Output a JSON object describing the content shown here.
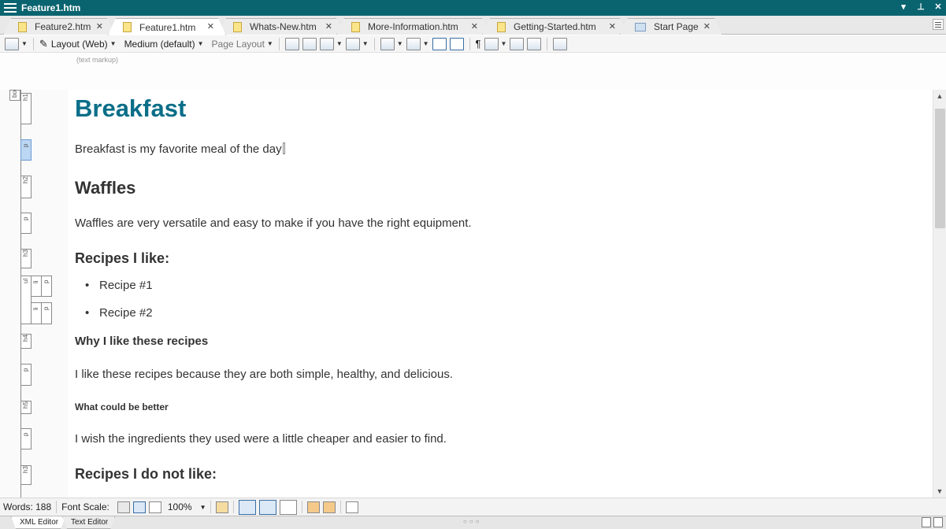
{
  "window": {
    "title": "Feature1.htm"
  },
  "tabs": [
    {
      "label": "Feature2.htm",
      "active": false
    },
    {
      "label": "Feature1.htm",
      "active": true
    },
    {
      "label": "Whats-New.htm",
      "active": false
    },
    {
      "label": "More-Information.htm",
      "active": false
    },
    {
      "label": "Getting-Started.htm",
      "active": false
    },
    {
      "label": "Start Page",
      "active": false
    }
  ],
  "toolbar": {
    "layout_label": "Layout (Web)",
    "medium_label": "Medium (default)",
    "page_layout_label": "Page Layout"
  },
  "markup_hint": "(text markup)",
  "gutter_tags": [
    "body",
    "h1",
    "p",
    "h2",
    "p",
    "h3",
    "ul",
    "li",
    "p",
    "li",
    "p",
    "h4",
    "p",
    "h5",
    "p",
    "h3"
  ],
  "document": {
    "h1": "Breakfast",
    "p1": "Breakfast is my favorite meal of the day",
    "h2": "Waffles",
    "p2": "Waffles are very versatile and easy to make if you have the right equipment.",
    "h3a": "Recipes I like:",
    "li1": "Recipe #1",
    "li2": "Recipe #2",
    "h4": "Why I like these recipes",
    "p3": "I like these recipes because they are both simple, healthy, and delicious.",
    "h5": "What could be better",
    "p4": "I wish the ingredients they used were a little cheaper and easier to find.",
    "h3b": "Recipes I do not like:"
  },
  "status": {
    "words": "Words: 188",
    "font_scale_label": "Font Scale:",
    "zoom": "100%"
  },
  "editor_tabs": [
    {
      "label": "XML Editor",
      "active": true
    },
    {
      "label": "Text Editor",
      "active": false
    }
  ],
  "colors": {
    "titlebar": "#0a6470",
    "heading1": "#0a6e88"
  }
}
